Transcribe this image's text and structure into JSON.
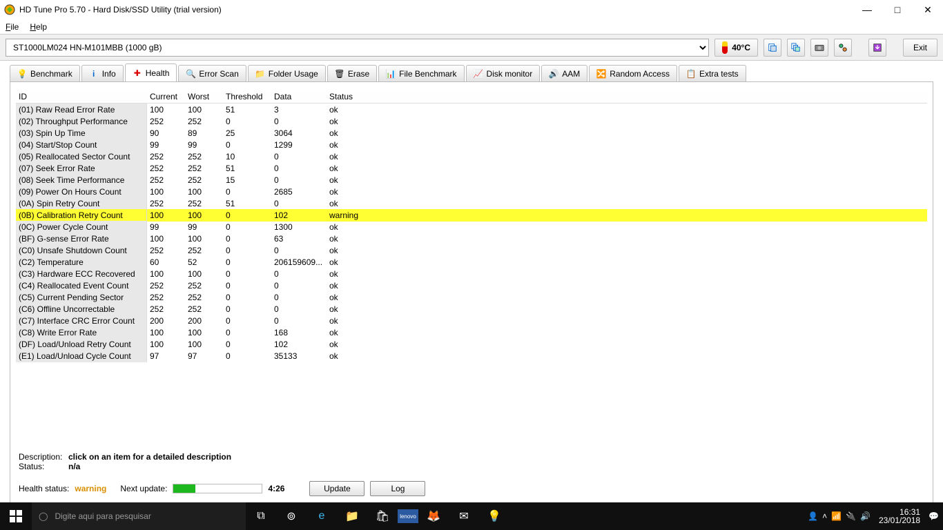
{
  "window": {
    "title": "HD Tune Pro 5.70 - Hard Disk/SSD Utility (trial version)"
  },
  "menu": {
    "file": "File",
    "help": "Help"
  },
  "device": "ST1000LM024 HN-M101MBB (1000 gB)",
  "temperature": "40°C",
  "exit_label": "Exit",
  "tabs": {
    "benchmark": "Benchmark",
    "info": "Info",
    "health": "Health",
    "error_scan": "Error Scan",
    "folder_usage": "Folder Usage",
    "erase": "Erase",
    "file_benchmark": "File Benchmark",
    "disk_monitor": "Disk monitor",
    "aam": "AAM",
    "random_access": "Random Access",
    "extra_tests": "Extra tests"
  },
  "columns": {
    "id": "ID",
    "current": "Current",
    "worst": "Worst",
    "threshold": "Threshold",
    "data": "Data",
    "status": "Status"
  },
  "rows": [
    {
      "id": "(01) Raw Read Error Rate",
      "cur": "100",
      "wor": "100",
      "thr": "51",
      "dat": "3",
      "sta": "ok"
    },
    {
      "id": "(02) Throughput Performance",
      "cur": "252",
      "wor": "252",
      "thr": "0",
      "dat": "0",
      "sta": "ok"
    },
    {
      "id": "(03) Spin Up Time",
      "cur": "90",
      "wor": "89",
      "thr": "25",
      "dat": "3064",
      "sta": "ok"
    },
    {
      "id": "(04) Start/Stop Count",
      "cur": "99",
      "wor": "99",
      "thr": "0",
      "dat": "1299",
      "sta": "ok"
    },
    {
      "id": "(05) Reallocated Sector Count",
      "cur": "252",
      "wor": "252",
      "thr": "10",
      "dat": "0",
      "sta": "ok"
    },
    {
      "id": "(07) Seek Error Rate",
      "cur": "252",
      "wor": "252",
      "thr": "51",
      "dat": "0",
      "sta": "ok"
    },
    {
      "id": "(08) Seek Time Performance",
      "cur": "252",
      "wor": "252",
      "thr": "15",
      "dat": "0",
      "sta": "ok"
    },
    {
      "id": "(09) Power On Hours Count",
      "cur": "100",
      "wor": "100",
      "thr": "0",
      "dat": "2685",
      "sta": "ok"
    },
    {
      "id": "(0A) Spin Retry Count",
      "cur": "252",
      "wor": "252",
      "thr": "51",
      "dat": "0",
      "sta": "ok"
    },
    {
      "id": "(0B) Calibration Retry Count",
      "cur": "100",
      "wor": "100",
      "thr": "0",
      "dat": "102",
      "sta": "warning",
      "warn": true
    },
    {
      "id": "(0C) Power Cycle Count",
      "cur": "99",
      "wor": "99",
      "thr": "0",
      "dat": "1300",
      "sta": "ok"
    },
    {
      "id": "(BF) G-sense Error Rate",
      "cur": "100",
      "wor": "100",
      "thr": "0",
      "dat": "63",
      "sta": "ok"
    },
    {
      "id": "(C0) Unsafe Shutdown Count",
      "cur": "252",
      "wor": "252",
      "thr": "0",
      "dat": "0",
      "sta": "ok"
    },
    {
      "id": "(C2) Temperature",
      "cur": "60",
      "wor": "52",
      "thr": "0",
      "dat": "206159609...",
      "sta": "ok"
    },
    {
      "id": "(C3) Hardware ECC Recovered",
      "cur": "100",
      "wor": "100",
      "thr": "0",
      "dat": "0",
      "sta": "ok"
    },
    {
      "id": "(C4) Reallocated Event Count",
      "cur": "252",
      "wor": "252",
      "thr": "0",
      "dat": "0",
      "sta": "ok"
    },
    {
      "id": "(C5) Current Pending Sector",
      "cur": "252",
      "wor": "252",
      "thr": "0",
      "dat": "0",
      "sta": "ok"
    },
    {
      "id": "(C6) Offline Uncorrectable",
      "cur": "252",
      "wor": "252",
      "thr": "0",
      "dat": "0",
      "sta": "ok"
    },
    {
      "id": "(C7) Interface CRC Error Count",
      "cur": "200",
      "wor": "200",
      "thr": "0",
      "dat": "0",
      "sta": "ok"
    },
    {
      "id": "(C8) Write Error Rate",
      "cur": "100",
      "wor": "100",
      "thr": "0",
      "dat": "168",
      "sta": "ok"
    },
    {
      "id": "(DF) Load/Unload Retry Count",
      "cur": "100",
      "wor": "100",
      "thr": "0",
      "dat": "102",
      "sta": "ok"
    },
    {
      "id": "(E1) Load/Unload Cycle Count",
      "cur": "97",
      "wor": "97",
      "thr": "0",
      "dat": "35133",
      "sta": "ok"
    }
  ],
  "description": {
    "label": "Description:",
    "value": "click on an item for a detailed description"
  },
  "status_line": {
    "label": "Status:",
    "value": "n/a"
  },
  "footer": {
    "health_label": "Health status:",
    "health_value": "warning",
    "next_update": "Next update:",
    "time": "4:26",
    "update_btn": "Update",
    "log_btn": "Log"
  },
  "taskbar": {
    "search_placeholder": "Digite aqui para pesquisar",
    "time": "16:31",
    "date": "23/01/2018"
  }
}
